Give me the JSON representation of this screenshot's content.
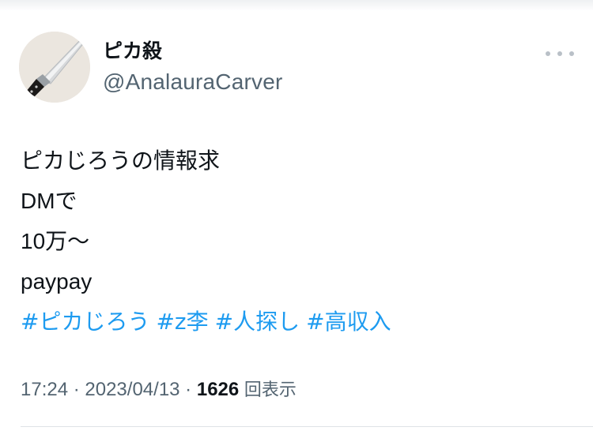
{
  "author": {
    "display_name": "ピカ殺",
    "handle": "@AnalauraCarver",
    "avatar_icon": "knife-icon"
  },
  "menu": {
    "more_icon": "more-horizontal-icon"
  },
  "tweet": {
    "lines": [
      "ピカじろうの情報求",
      "DMで",
      "10万〜",
      "paypay"
    ],
    "hashtags": [
      "#ピカじろう",
      "#z李",
      "#人探し",
      "#高収入"
    ]
  },
  "meta": {
    "time": "17:24",
    "separator": " · ",
    "date": "2023/04/13",
    "views_count": "1626",
    "views_label": "回表示"
  },
  "colors": {
    "hashtag": "#1d9bf0",
    "secondary_text": "#536471",
    "primary_text": "#0f1419"
  }
}
